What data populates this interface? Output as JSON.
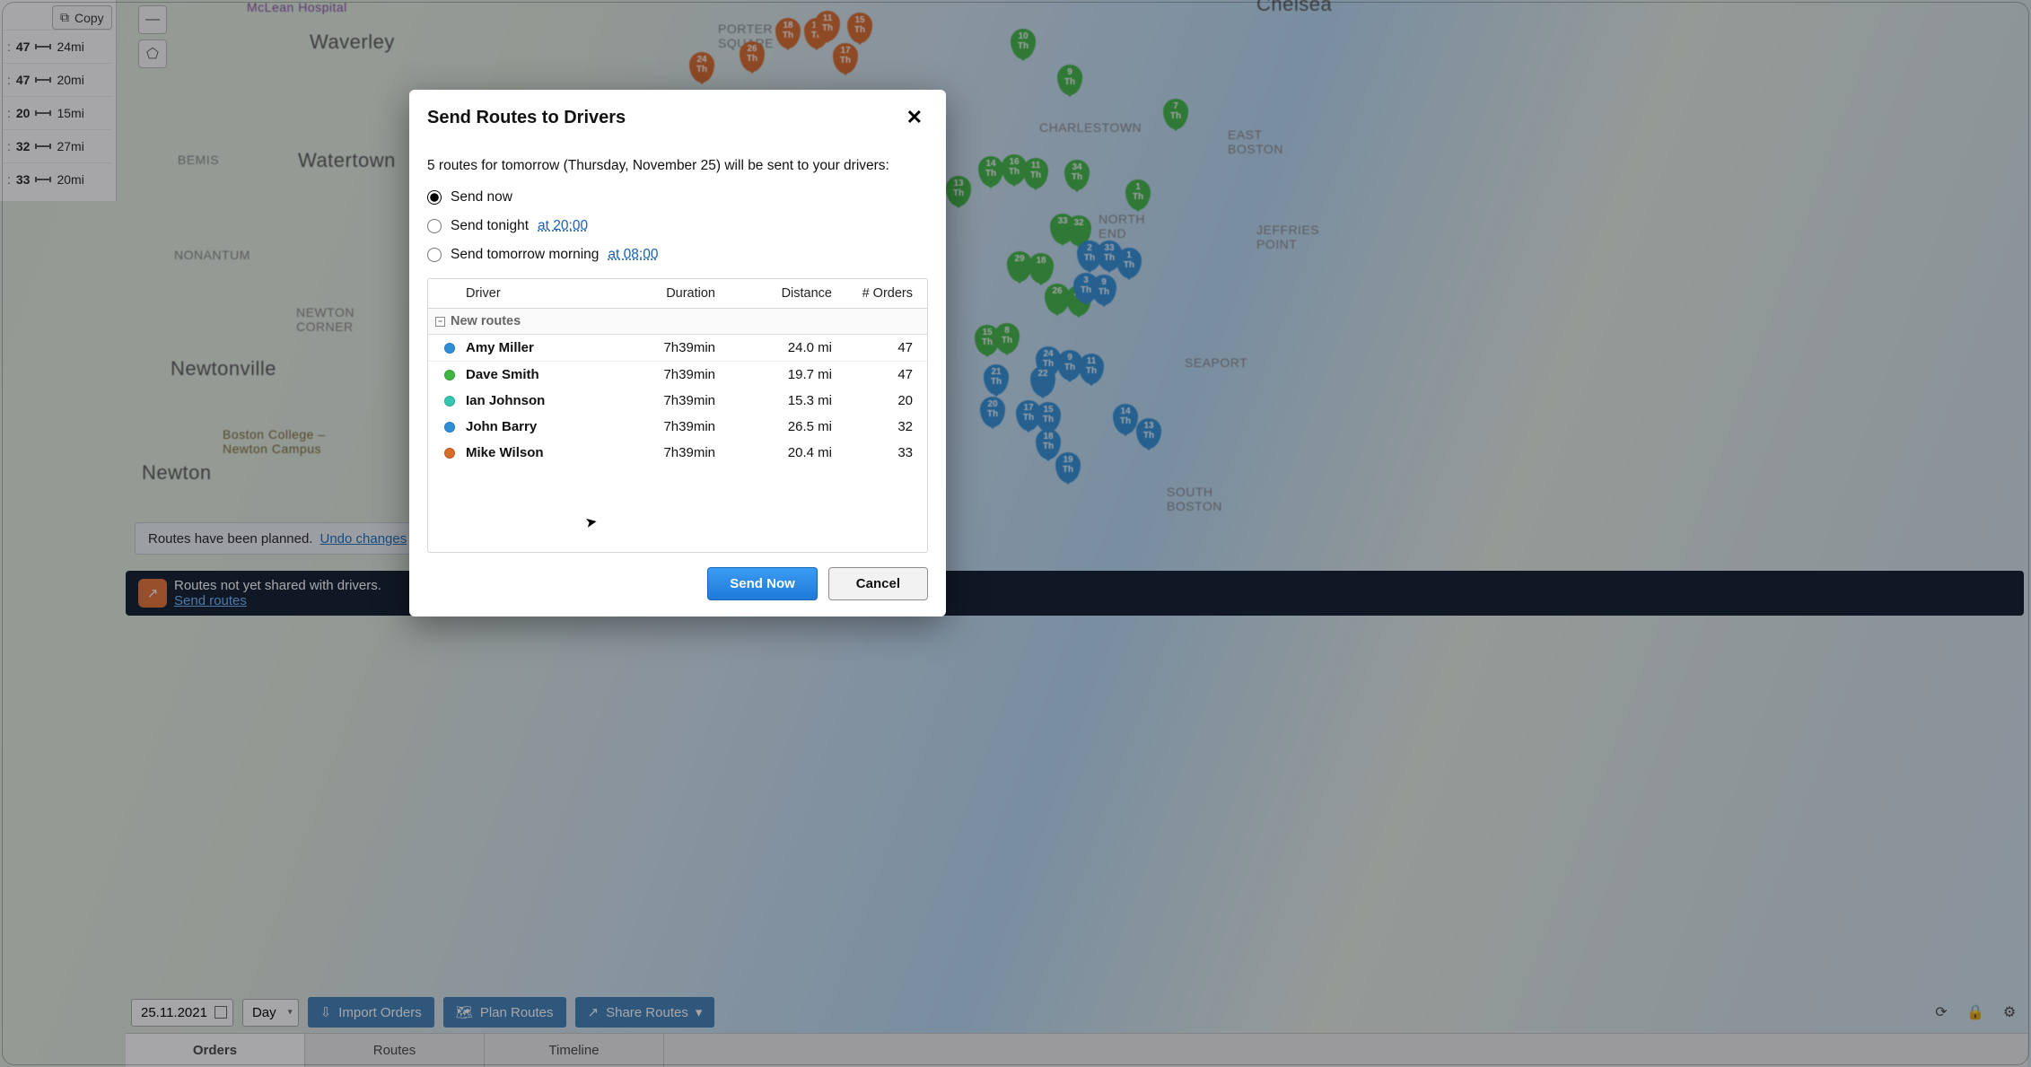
{
  "map": {
    "labels": {
      "mclean": "McLean Hospital",
      "waverley": "Waverley",
      "watertown": "Watertown",
      "newton": "Newton",
      "newtonville": "Newtonville",
      "bemis": "BEMIS",
      "nonantum": "NONANTUM",
      "newton_corner": "NEWTON CORNER",
      "boston_college": "Boston College – Newton Campus",
      "porter_square": "PORTER SQUARE",
      "charlestown": "CHARLESTOWN",
      "east_boston": "EAST BOSTON",
      "jeffries_point": "JEFFRIES POINT",
      "seaport": "SEAPORT",
      "south_boston": "SOUTH BOSTON",
      "north_end": "NORTH END",
      "chelsea": "Chelsea"
    }
  },
  "side": {
    "copy": "Copy",
    "rows": [
      {
        "num": "47",
        "dist": "24mi"
      },
      {
        "num": "47",
        "dist": "20mi"
      },
      {
        "num": "20",
        "dist": "15mi"
      },
      {
        "num": "32",
        "dist": "27mi"
      },
      {
        "num": "33",
        "dist": "20mi"
      }
    ]
  },
  "banner_light": {
    "text": "Routes have been planned.",
    "link": "Undo changes"
  },
  "banner_dark": {
    "text": "Routes not yet shared with drivers.",
    "link": "Send routes"
  },
  "toolbar": {
    "date": "25.11.2021",
    "view": "Day",
    "import": "Import Orders",
    "plan": "Plan Routes",
    "share": "Share Routes"
  },
  "tabs": {
    "orders": "Orders",
    "routes": "Routes",
    "timeline": "Timeline"
  },
  "modal": {
    "title": "Send Routes to Drivers",
    "lead": "5 routes for tomorrow (Thursday, November 25) will be sent to your drivers:",
    "opt_now": "Send now",
    "opt_tonight_prefix": "Send tonight ",
    "opt_tonight_time": "at 20:00",
    "opt_morning_prefix": "Send tomorrow morning ",
    "opt_morning_time": "at 08:00",
    "columns": {
      "driver": "Driver",
      "duration": "Duration",
      "distance": "Distance",
      "orders": "# Orders"
    },
    "group": "New routes",
    "rows": [
      {
        "color": "blue",
        "name": "Amy Miller",
        "duration": "7h39min",
        "distance": "24.0 mi",
        "orders": "47"
      },
      {
        "color": "green",
        "name": "Dave Smith",
        "duration": "7h39min",
        "distance": "19.7 mi",
        "orders": "47"
      },
      {
        "color": "teal",
        "name": "Ian Johnson",
        "duration": "7h39min",
        "distance": "15.3 mi",
        "orders": "20"
      },
      {
        "color": "blue",
        "name": "John Barry",
        "duration": "7h39min",
        "distance": "26.5 mi",
        "orders": "32"
      },
      {
        "color": "orange",
        "name": "Mike Wilson",
        "duration": "7h39min",
        "distance": "20.4 mi",
        "orders": "33"
      }
    ],
    "send": "Send Now",
    "cancel": "Cancel"
  }
}
